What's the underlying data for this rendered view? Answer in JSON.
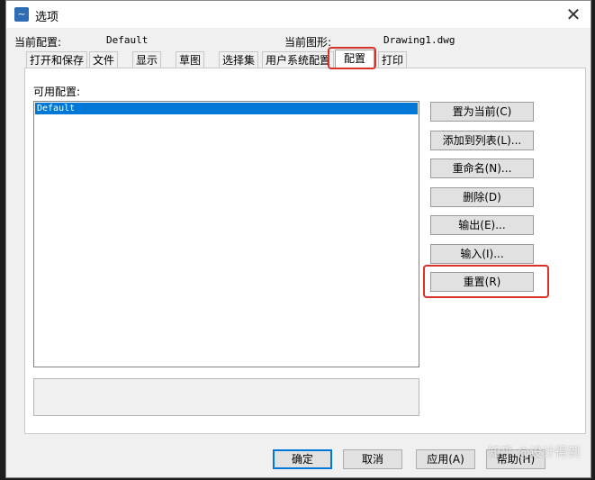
{
  "window": {
    "title": "选项",
    "icon_glyph": "~",
    "close_glyph": "✕"
  },
  "header": {
    "profile_label": "当前配置:",
    "profile_value": "Default",
    "drawing_label": "当前图形:",
    "drawing_value": "Drawing1.dwg"
  },
  "tabs": [
    {
      "label": "打开和保存"
    },
    {
      "label": "文件"
    },
    {
      "label": "显示"
    },
    {
      "label": "草图"
    },
    {
      "label": "选择集"
    },
    {
      "label": "用户系统配置"
    },
    {
      "label": "配置",
      "active": true
    },
    {
      "label": "打印"
    }
  ],
  "profiles": {
    "label": "可用配置:",
    "items": [
      "Default"
    ],
    "selected": "Default"
  },
  "side_buttons": [
    {
      "label": "置为当前(C)"
    },
    {
      "label": "添加到列表(L)..."
    },
    {
      "label": "重命名(N)..."
    },
    {
      "label": "删除(D)"
    },
    {
      "label": "输出(E)..."
    },
    {
      "label": "输入(I)..."
    },
    {
      "label": "重置(R)"
    }
  ],
  "footer_buttons": [
    {
      "label": "确定"
    },
    {
      "label": "取消"
    },
    {
      "label": "应用(A)"
    },
    {
      "label": "帮助(H)"
    }
  ],
  "watermark": "知乎 @设计得到",
  "colors": {
    "highlight": "#d9322a",
    "selection": "#0078d7",
    "dialog_bg": "#f0f0f0"
  }
}
